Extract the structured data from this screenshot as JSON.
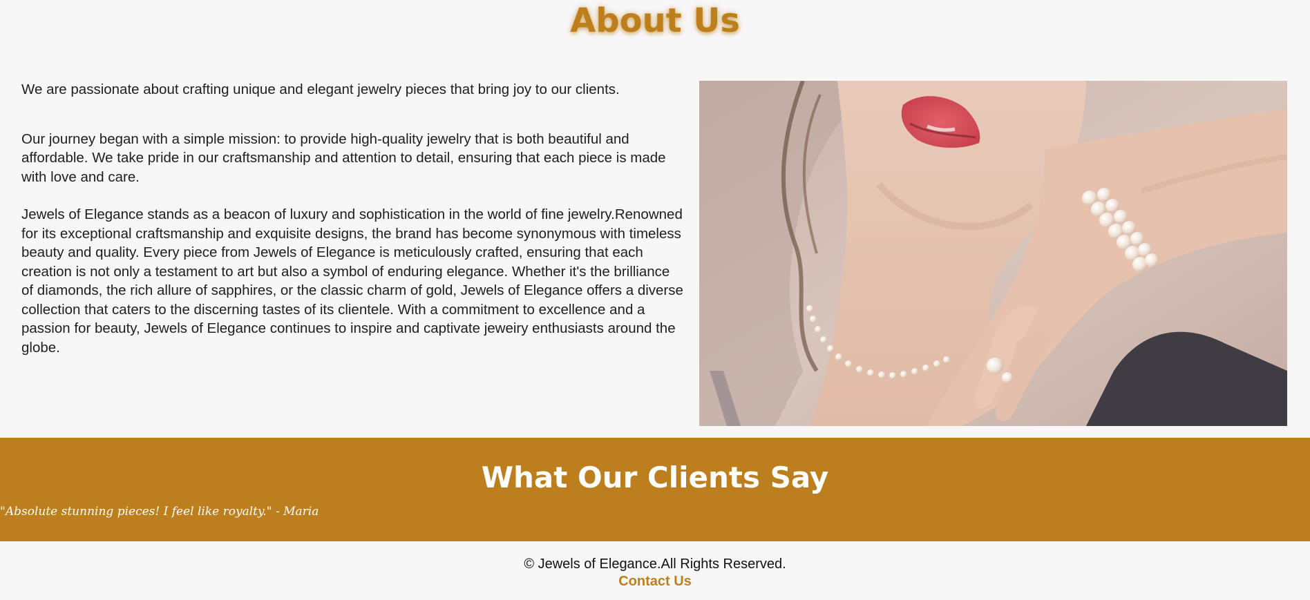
{
  "about": {
    "title": "About Us",
    "intro": "We are passionate about crafting unique and elegant jewelry pieces that bring joy to our clients.",
    "journey": "Our journey began with a simple mission: to provide high-quality jewelry that is both beautiful and affordable. We take pride in our craftsmanship and attention to detail, ensuring that each piece is made with love and care.",
    "brand_story": "Jewels of Elegance stands as a beacon of luxury and sophistication in the world of fine jewelry.Renowned for its exceptional craftsmanship and exquisite designs, the brand has become synonymous with timeless beauty and quality. Every piece from Jewels of Elegance is meticulously crafted, ensuring that each creation is not only a testament to art but also a symbol of enduring elegance. Whether it's the brilliance of diamonds, the rich allure of sapphires, or the classic charm of gold, Jewels of Elegance offers a diverse collection that caters to the discerning tastes of its clientele. With a commitment to excellence and a passion for beauty, Jewels of Elegance continues to inspire and captivate jeweiry enthusiasts around the globe."
  },
  "testimonials": {
    "title": "What Our Clients Say",
    "quote": "\"Absolute stunning pieces! I feel like royalty.\" - Maria"
  },
  "footer": {
    "copyright": "© Jewels of Elegance.All Rights Reserved.",
    "contact_label": "Contact Us"
  },
  "colors": {
    "accent": "#bd7f1c",
    "band": "#bd7e1d",
    "background": "#f8f7f7"
  }
}
